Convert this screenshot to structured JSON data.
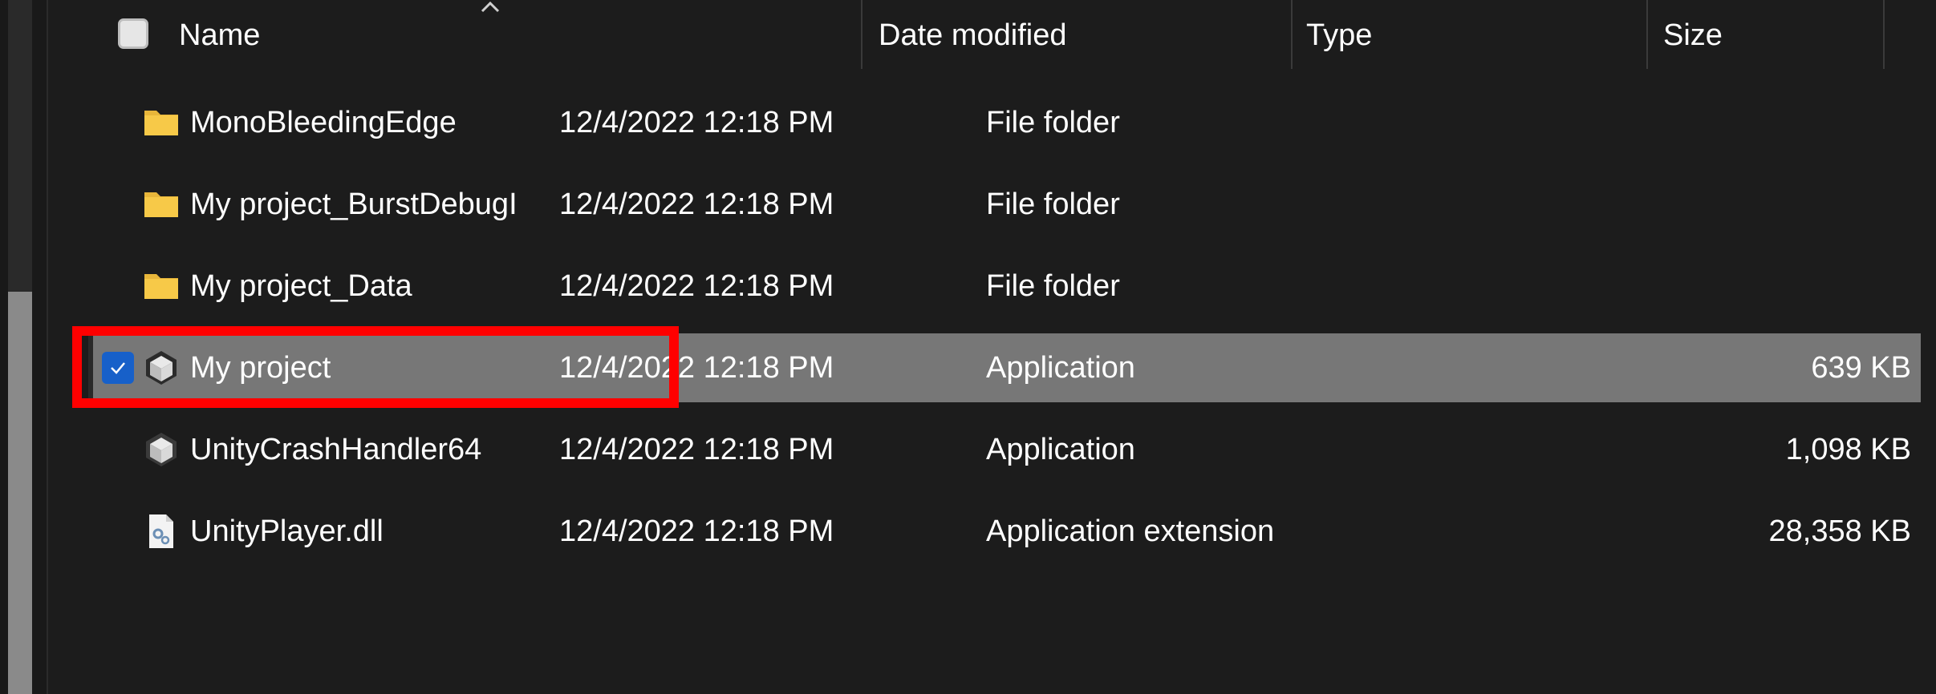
{
  "columns": {
    "name": "Name",
    "date_modified": "Date modified",
    "type": "Type",
    "size": "Size"
  },
  "rows": [
    {
      "name": "MonoBleedingEdge",
      "date": "12/4/2022 12:18 PM",
      "type": "File folder",
      "size": "",
      "icon": "folder-icon"
    },
    {
      "name": "My project_BurstDebugInformation_DoNotS...",
      "date": "12/4/2022 12:18 PM",
      "type": "File folder",
      "size": "",
      "icon": "folder-icon"
    },
    {
      "name": "My project_Data",
      "date": "12/4/2022 12:18 PM",
      "type": "File folder",
      "size": "",
      "icon": "folder-icon"
    },
    {
      "name": "My project",
      "date": "12/4/2022 12:18 PM",
      "type": "Application",
      "size": "639 KB",
      "icon": "unity-app-icon",
      "selected": true
    },
    {
      "name": "UnityCrashHandler64",
      "date": "12/4/2022 12:18 PM",
      "type": "Application",
      "size": "1,098 KB",
      "icon": "unity-app-icon"
    },
    {
      "name": "UnityPlayer.dll",
      "date": "12/4/2022 12:18 PM",
      "type": "Application extension",
      "size": "28,358 KB",
      "icon": "dll-file-icon"
    }
  ],
  "colors": {
    "background": "#1c1c1c",
    "selected_row": "#777777",
    "checkbox_accent": "#1760c9",
    "annotation": "#ff0000",
    "folder": "#f7c948"
  }
}
